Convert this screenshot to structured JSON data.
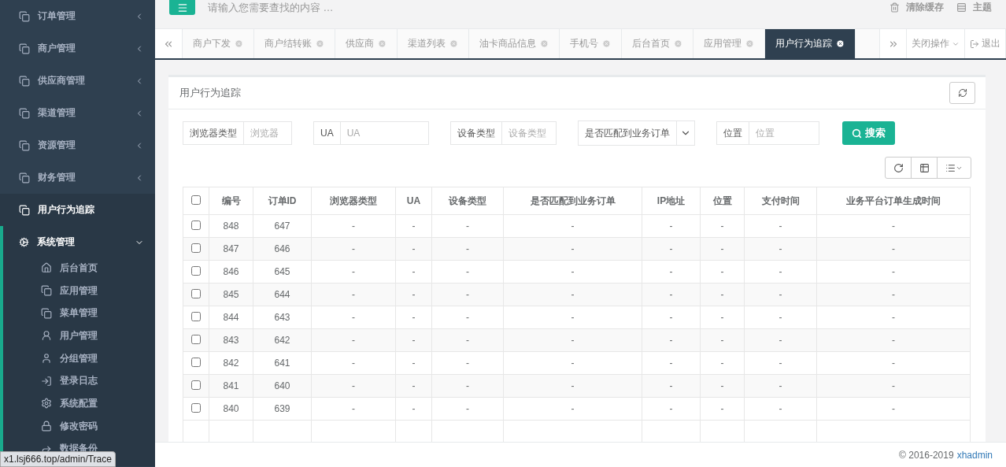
{
  "sidebar": {
    "items": [
      {
        "label": "订单管理",
        "expanded": false,
        "selected": false
      },
      {
        "label": "商户管理",
        "expanded": false,
        "selected": false
      },
      {
        "label": "供应商管理",
        "expanded": false,
        "selected": false
      },
      {
        "label": "渠道管理",
        "expanded": false,
        "selected": false
      },
      {
        "label": "资源管理",
        "expanded": false,
        "selected": false
      },
      {
        "label": "财务管理",
        "expanded": false,
        "selected": false
      },
      {
        "label": "用户行为追踪",
        "selected": false,
        "hovered": true
      },
      {
        "label": "系统管理",
        "expanded": true,
        "selected": true,
        "children": [
          {
            "label": "后台首页",
            "selected": false
          },
          {
            "label": "应用管理",
            "selected": false
          },
          {
            "label": "菜单管理",
            "selected": false
          },
          {
            "label": "用户管理",
            "selected": false
          },
          {
            "label": "分组管理",
            "selected": false
          },
          {
            "label": "登录日志",
            "selected": false
          },
          {
            "label": "系统配置",
            "selected": false
          },
          {
            "label": "修改密码",
            "selected": false
          },
          {
            "label": "数据备份",
            "selected": false
          }
        ]
      }
    ]
  },
  "topbar": {
    "search_placeholder": "请输入您需要查找的内容 …",
    "actions": [
      {
        "label": "清除缓存",
        "kind": "trash"
      },
      {
        "label": "主题",
        "kind": "theme"
      }
    ]
  },
  "tabs": [
    {
      "label": "商户下发",
      "selected": false
    },
    {
      "label": "商户结转账",
      "selected": false
    },
    {
      "label": "供应商",
      "selected": false
    },
    {
      "label": "渠道列表",
      "selected": false
    },
    {
      "label": "油卡商品信息",
      "selected": false
    },
    {
      "label": "手机号",
      "selected": false
    },
    {
      "label": "后台首页",
      "selected": false
    },
    {
      "label": "应用管理",
      "selected": false
    },
    {
      "label": "用户行为追踪",
      "selected": true
    }
  ],
  "tab_actions": {
    "close_menu": "关闭操作",
    "logout": "退出"
  },
  "panel": {
    "title": "用户行为追踪",
    "filters": [
      {
        "kind": "input",
        "label": "浏览器类型",
        "placeholder": "浏览器"
      },
      {
        "kind": "input",
        "label": "UA",
        "placeholder": "UA"
      },
      {
        "kind": "input",
        "label": "设备类型",
        "placeholder": "设备类型"
      },
      {
        "kind": "select",
        "value": "是否匹配到业务订单"
      },
      {
        "kind": "input",
        "label": "位置",
        "placeholder": "位置"
      }
    ],
    "search_button": "搜索",
    "table": {
      "select_all_checked": false,
      "columns": [
        "编号",
        "订单ID",
        "浏览器类型",
        "UA",
        "设备类型",
        "是否匹配到业务订单",
        "IP地址",
        "位置",
        "支付时间",
        "业务平台订单生成时间"
      ],
      "rows": [
        {
          "checked": false,
          "cells": [
            "848",
            "647",
            "-",
            "-",
            "-",
            "-",
            "-",
            "-",
            "-",
            "-"
          ]
        },
        {
          "checked": false,
          "cells": [
            "847",
            "646",
            "-",
            "-",
            "-",
            "-",
            "-",
            "-",
            "-",
            "-"
          ]
        },
        {
          "checked": false,
          "cells": [
            "846",
            "645",
            "-",
            "-",
            "-",
            "-",
            "-",
            "-",
            "-",
            "-"
          ]
        },
        {
          "checked": false,
          "cells": [
            "845",
            "644",
            "-",
            "-",
            "-",
            "-",
            "-",
            "-",
            "-",
            "-"
          ]
        },
        {
          "checked": false,
          "cells": [
            "844",
            "643",
            "-",
            "-",
            "-",
            "-",
            "-",
            "-",
            "-",
            "-"
          ]
        },
        {
          "checked": false,
          "cells": [
            "843",
            "642",
            "-",
            "-",
            "-",
            "-",
            "-",
            "-",
            "-",
            "-"
          ]
        },
        {
          "checked": false,
          "cells": [
            "842",
            "641",
            "-",
            "-",
            "-",
            "-",
            "-",
            "-",
            "-",
            "-"
          ]
        },
        {
          "checked": false,
          "cells": [
            "841",
            "640",
            "-",
            "-",
            "-",
            "-",
            "-",
            "-",
            "-",
            "-"
          ]
        },
        {
          "checked": false,
          "cells": [
            "840",
            "639",
            "-",
            "-",
            "-",
            "-",
            "-",
            "-",
            "-",
            "-"
          ]
        }
      ]
    }
  },
  "footer": {
    "copyright": "© 2016-2019",
    "link": "xhadmin"
  },
  "status_url": "x1.lsj666.top/admin/Trace"
}
